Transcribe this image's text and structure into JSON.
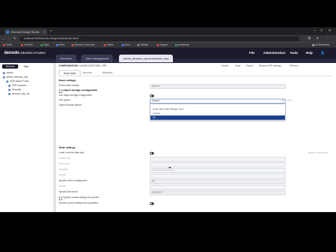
{
  "browser": {
    "tab_title": "Denodo Design Studio",
    "url": "localhost:9443/denodo-design-studio/#/vdp-view/...",
    "bookmarks": [
      "Gmail",
      "YouTube",
      "Maps",
      "News",
      "Denodo Community",
      "Videos",
      "Docs",
      "Settings",
      "Support",
      "Downloads",
      "All Bookmarks"
    ]
  },
  "app": {
    "logo": "denodo",
    "logo_suffix": "DESIGN STUDIO",
    "menus": [
      "File",
      "Administration",
      "Tools",
      "Help"
    ],
    "workspace_tabs": [
      "Welcome",
      "User management",
      "admin_denodo_vsp.embedded_repo"
    ]
  },
  "sidebar": {
    "tabs": [
      "Servers",
      "Tags"
    ],
    "tree": [
      "admin",
      "admin_denodo_vsp",
      "VDP Admin Tools",
      "VDP sources",
      "Security",
      "denodo_vsp_db"
    ]
  },
  "main": {
    "breadcrumb": [
      "CONFIGURATION",
      "LINKED DATA TASK",
      "VSP"
    ],
    "toolbar": [
      "Cancel",
      "Save",
      "Export",
      "Restore VDP settings",
      "Refresh"
    ],
    "sub_tabs": [
      "Read Write",
      "Services",
      "Metadata"
    ],
    "sections": {
      "basic_settings": "Basic settings",
      "object_storage": "Object storage configuration",
      "write_settings": "Write settings"
    },
    "labels": {
      "stored_path": "Stored data location",
      "use_object_storage": "Use object storage configuration",
      "file_system": "File system",
      "object_storage_system": "Object storage system",
      "use_local_path": "Local to server data only",
      "specific_config": "Specific driver configuration",
      "specific_file_format": "Specific file format",
      "file_cache": "Specify custom settings for queries",
      "specify_custom": "Specify custom settings and properties",
      "dim1": "Access key",
      "dim2": "Secret key",
      "dim3": "Endpoint",
      "dim4": "Region",
      "dim5": "Bucket"
    },
    "values": {
      "stored_path": "denodo",
      "file_system_selected": "Custom",
      "specific_config": "S3",
      "specific_file_format": "PARQUET",
      "dim3_value": "/opt/denodo/data/temp"
    },
    "dropdown_options": [
      "Azure Data Lake Storage Gen2",
      "Custom",
      "S3"
    ],
    "dropdown_selected_index": 2,
    "notes": {
      "right_note": "Apply",
      "side_note": "Specific configuration"
    }
  }
}
